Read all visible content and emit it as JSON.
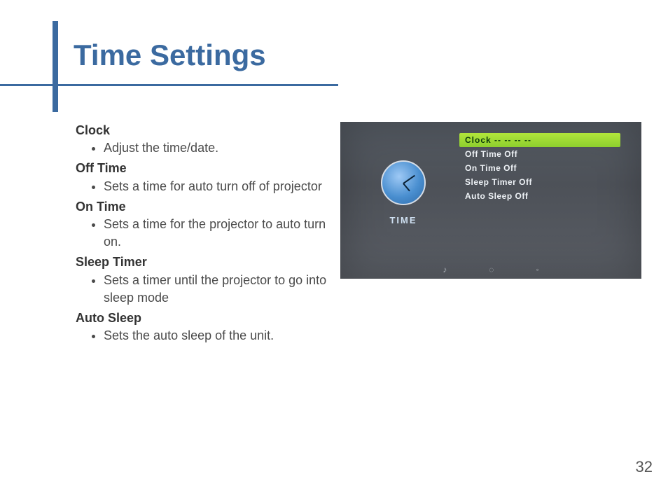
{
  "header": {
    "title": "Time Settings"
  },
  "sections": [
    {
      "heading": "Clock",
      "bullet": "Adjust the time/date."
    },
    {
      "heading": "Off Time",
      "bullet": "Sets a time for auto turn off of projector"
    },
    {
      "heading": "On Time",
      "bullet": "Sets a time for the projector to auto turn on."
    },
    {
      "heading": "Sleep Timer",
      "bullet": "Sets a timer until the projector to go into sleep mode"
    },
    {
      "heading": "Auto Sleep",
      "bullet": "Sets the auto sleep of the unit."
    }
  ],
  "screenshot": {
    "side_label": "TIME",
    "highlight": "Clock --   --    --  --",
    "items": [
      "Off Time Off",
      "On Time Off",
      "Sleep Timer Off",
      "Auto Sleep Off"
    ],
    "bottom_icons": [
      "♪",
      "◌",
      "◦"
    ]
  },
  "page_number": "32"
}
